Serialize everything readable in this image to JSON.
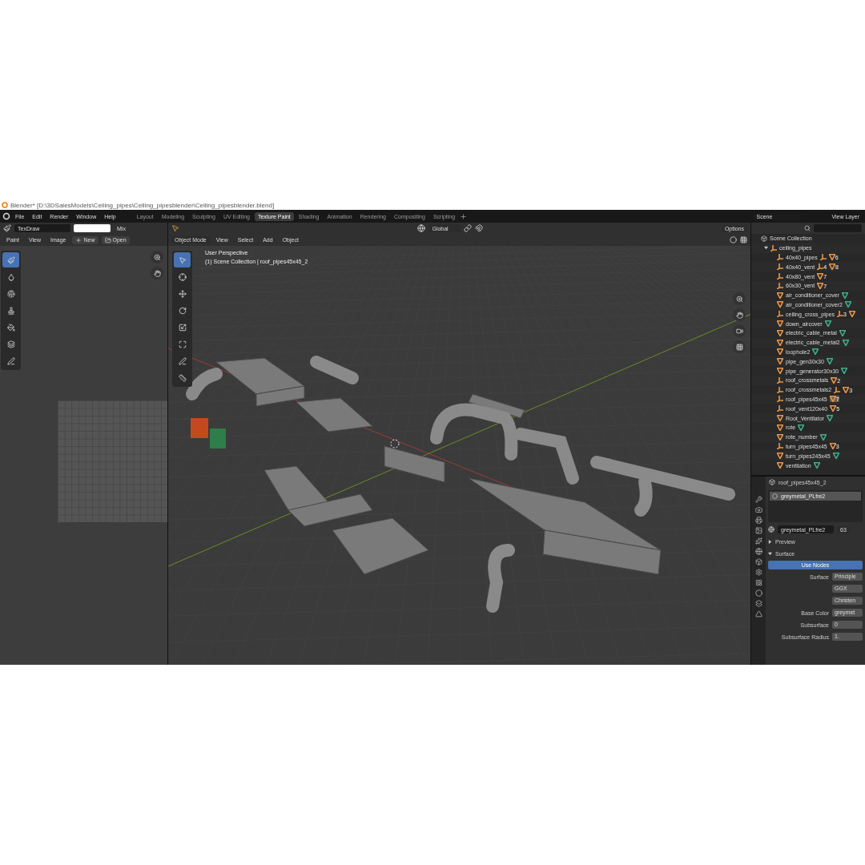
{
  "title_bar": {
    "title": "Blender* [D:\\3DSalesModels\\Ceiling_pipes\\Ceiling_pipesblender\\Ceiling_pipesblender.blend]"
  },
  "menu": [
    "File",
    "Edit",
    "Render",
    "Window",
    "Help"
  ],
  "workspaces": [
    {
      "label": "Layout",
      "selected": false
    },
    {
      "label": "Modeling",
      "selected": false
    },
    {
      "label": "Sculpting",
      "selected": false
    },
    {
      "label": "UV Editing",
      "selected": false
    },
    {
      "label": "Texture Paint",
      "selected": true
    },
    {
      "label": "Shading",
      "selected": false
    },
    {
      "label": "Animation",
      "selected": false
    },
    {
      "label": "Rendering",
      "selected": false
    },
    {
      "label": "Compositing",
      "selected": false
    },
    {
      "label": "Scripting",
      "selected": false
    }
  ],
  "scene": {
    "label": "Scene"
  },
  "view_layer": {
    "label": "View Layer"
  },
  "image_editor": {
    "brush": "TexDraw",
    "blend": "Mix",
    "mode": "Paint",
    "menus": [
      "View",
      "Image"
    ],
    "buttons": [
      {
        "kind": "new",
        "label": "New"
      },
      {
        "kind": "open",
        "label": "Open"
      }
    ],
    "tools": [
      {
        "kind": "draw",
        "selected": true
      },
      {
        "kind": "soften",
        "selected": false
      },
      {
        "kind": "smear",
        "selected": false
      },
      {
        "kind": "clone",
        "selected": false
      },
      {
        "kind": "fill",
        "selected": false
      },
      {
        "kind": "mask",
        "selected": false
      },
      {
        "kind": "annotate",
        "selected": false
      }
    ]
  },
  "viewport": {
    "orientation": "Global",
    "options": "Options",
    "mode": "Object Mode",
    "menus": [
      "View",
      "Select",
      "Add",
      "Object"
    ],
    "overlay_lines": [
      "User Perspective",
      "(1) Scene Collection | roof_pipes45x45_2"
    ],
    "tools": [
      {
        "kind": "select",
        "selected": true
      },
      {
        "kind": "cursor",
        "selected": false
      },
      {
        "kind": "move",
        "selected": false
      },
      {
        "kind": "rotate",
        "selected": false
      },
      {
        "kind": "scale",
        "selected": false
      },
      {
        "kind": "transform",
        "selected": false
      },
      {
        "kind": "annotate",
        "selected": false
      },
      {
        "kind": "measure",
        "selected": false
      }
    ]
  },
  "outliner": {
    "root": "Scene Collection",
    "collection": {
      "name": "ceiling_pipes",
      "expanded": true,
      "children": [
        {
          "name": "40x40_pipes",
          "kind": "empty",
          "selected": false,
          "badges": [
            {
              "kind": "empty"
            },
            {
              "kind": "mesh",
              "count": "6"
            }
          ]
        },
        {
          "name": "40x40_vent",
          "kind": "empty",
          "selected": false,
          "badges": [
            {
              "kind": "empty",
              "count": "4"
            },
            {
              "kind": "mesh",
              "count": "8"
            }
          ]
        },
        {
          "name": "40x80_vent",
          "kind": "empty",
          "selected": false,
          "badges": [
            {
              "kind": "mesh",
              "count": "7"
            }
          ]
        },
        {
          "name": "60x30_vent",
          "kind": "empty",
          "selected": false,
          "badges": [
            {
              "kind": "mesh",
              "count": "7"
            }
          ]
        },
        {
          "name": "air_conditioner_cover",
          "kind": "mesh",
          "selected": false,
          "badges": [
            {
              "kind": "data"
            }
          ]
        },
        {
          "name": "air_conditioner_cover2",
          "kind": "mesh",
          "selected": false,
          "badges": [
            {
              "kind": "data"
            }
          ]
        },
        {
          "name": "ceiling_cross_pipes",
          "kind": "empty",
          "selected": false,
          "badges": [
            {
              "kind": "empty",
              "count": "3"
            },
            {
              "kind": "mesh"
            }
          ]
        },
        {
          "name": "down_aircover",
          "kind": "mesh",
          "selected": false,
          "badges": [
            {
              "kind": "data"
            }
          ]
        },
        {
          "name": "electric_cable_metal",
          "kind": "mesh",
          "selected": false,
          "badges": [
            {
              "kind": "data"
            }
          ]
        },
        {
          "name": "electric_cable_metal2",
          "kind": "mesh",
          "selected": false,
          "badges": [
            {
              "kind": "data"
            }
          ]
        },
        {
          "name": "loophole2",
          "kind": "mesh",
          "selected": false,
          "badges": [
            {
              "kind": "data"
            }
          ]
        },
        {
          "name": "pipe_gen30x30",
          "kind": "mesh",
          "selected": false,
          "badges": [
            {
              "kind": "data"
            }
          ]
        },
        {
          "name": "pipe_generator30x30",
          "kind": "mesh",
          "selected": false,
          "badges": [
            {
              "kind": "data"
            }
          ]
        },
        {
          "name": "roof_crossmetals",
          "kind": "empty",
          "selected": false,
          "badges": [
            {
              "kind": "mesh",
              "count": "2"
            }
          ]
        },
        {
          "name": "roof_crossmetals2",
          "kind": "empty",
          "selected": false,
          "badges": [
            {
              "kind": "empty"
            },
            {
              "kind": "mesh",
              "count": "3"
            }
          ]
        },
        {
          "name": "roof_pipes45x45",
          "kind": "empty",
          "selected": true,
          "badges": [
            {
              "kind": "mesh",
              "count": "7"
            }
          ]
        },
        {
          "name": "roof_vent120x40",
          "kind": "empty",
          "selected": false,
          "badges": [
            {
              "kind": "mesh",
              "count": "5"
            }
          ]
        },
        {
          "name": "Root_Ventilator",
          "kind": "mesh",
          "selected": false,
          "badges": [
            {
              "kind": "data"
            }
          ]
        },
        {
          "name": "rote",
          "kind": "mesh",
          "selected": false,
          "badges": [
            {
              "kind": "data"
            }
          ]
        },
        {
          "name": "rote_number",
          "kind": "mesh",
          "selected": false,
          "badges": [
            {
              "kind": "data"
            }
          ]
        },
        {
          "name": "turn_pipes45x45",
          "kind": "empty",
          "selected": false,
          "badges": [
            {
              "kind": "mesh",
              "count": "3"
            }
          ]
        },
        {
          "name": "turn_pipes245x45",
          "kind": "mesh",
          "selected": false,
          "badges": [
            {
              "kind": "data"
            }
          ]
        },
        {
          "name": "ventilation",
          "kind": "mesh",
          "selected": false,
          "badges": [
            {
              "kind": "data"
            }
          ]
        }
      ]
    }
  },
  "properties": {
    "object": "roof_pipes45x45_2",
    "slot": "greymetal_PLfre2",
    "material": "greymetal_PLfre2",
    "users": "63",
    "panels": [
      {
        "label": "Preview",
        "expanded": false
      },
      {
        "label": "Surface",
        "expanded": true
      }
    ],
    "use_nodes": "Use Nodes",
    "fields": [
      {
        "label": "Surface",
        "value": "Principle"
      },
      {
        "value": "GGX"
      },
      {
        "value": "Christen"
      },
      {
        "label": "Base Color",
        "value": "greymet"
      },
      {
        "label": "Subsurface",
        "value": "0"
      },
      {
        "label": "Subsurface Radius",
        "value": "1."
      }
    ]
  }
}
